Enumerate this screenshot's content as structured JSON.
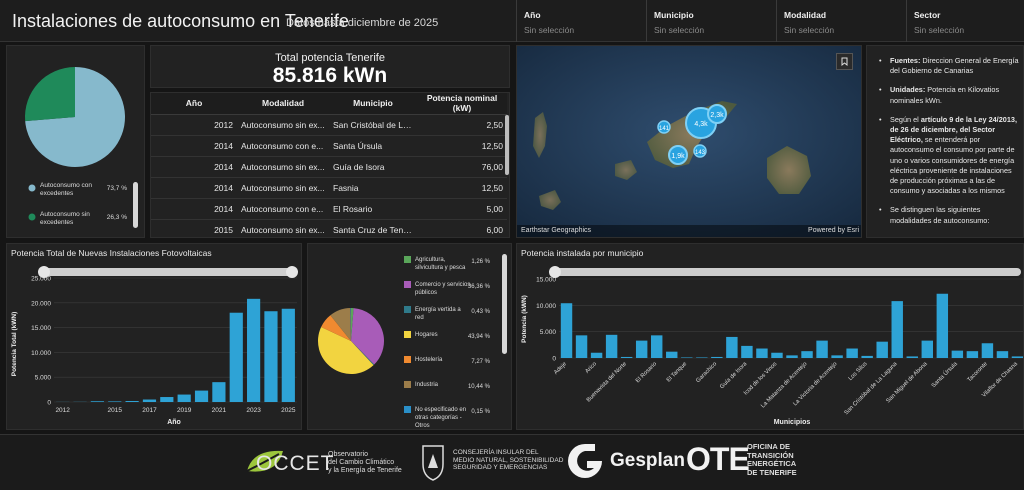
{
  "header": {
    "title": "Instalaciones de autoconsumo en Tenerife",
    "subtitle": "Datos hasta diciembre de 2025",
    "filters": [
      {
        "label": "Año",
        "value": "Sin selección"
      },
      {
        "label": "Municipio",
        "value": "Sin selección"
      },
      {
        "label": "Modalidad",
        "value": "Sin selección"
      },
      {
        "label": "Sector",
        "value": "Sin selección"
      }
    ]
  },
  "total": {
    "label": "Total potencia Tenerife",
    "value": "85.816 kWn"
  },
  "table": {
    "columns": [
      "Año",
      "Modalidad",
      "Municipio",
      "Potencia nominal (kW)"
    ],
    "rows": [
      [
        "2012",
        "Autoconsumo sin ex...",
        "San Cristóbal de La ...",
        "2,50"
      ],
      [
        "2014",
        "Autoconsumo con e...",
        "Santa Úrsula",
        "12,50"
      ],
      [
        "2014",
        "Autoconsumo sin ex...",
        "Guía de Isora",
        "76,00"
      ],
      [
        "2014",
        "Autoconsumo sin ex...",
        "Fasnia",
        "12,50"
      ],
      [
        "2014",
        "Autoconsumo con e...",
        "El Rosario",
        "5,00"
      ],
      [
        "2015",
        "Autoconsumo sin ex...",
        "Santa Cruz de Tenerife",
        "6,00"
      ]
    ]
  },
  "map": {
    "clusters": [
      "4,3k",
      "2,3k",
      "141",
      "1,9k",
      "143"
    ],
    "attribution": "Earthstar Geographics",
    "powered": "Powered by Esri",
    "bookmark_icon": "bookmark-icon"
  },
  "info": {
    "items": [
      {
        "bold": "Fuentes:",
        "text": " Direccion General de Energía del Gobierno de Canarias"
      },
      {
        "bold": "Unidades:",
        "text": " Potencia en Kilovatios nominales kWn."
      },
      {
        "pre": "Según el ",
        "bold": "artículo 9 de la Ley 24/2013, de 26 de diciembre, del Sector Eléctrico,",
        "text": " se entenderá por autoconsumo el consumo por parte de uno o varios consumidores de energía eléctrica proveniente de instalaciones de producción próximas a las de consumo y asociadas a los mismos"
      },
      {
        "text": "Se distinguen las siguientes modalidades de autoconsumo:"
      }
    ]
  },
  "chart_data": [
    {
      "type": "pie",
      "categories": [
        "Autoconsumo con excedentes",
        "Autoconsumo sin excedentes"
      ],
      "values": [
        73.7,
        26.3
      ],
      "labels": [
        "73,7 %",
        "26,3 %"
      ],
      "colors": [
        "#86b9cc",
        "#1f8a5a"
      ]
    },
    {
      "type": "bar",
      "title": "Potencia Total de Nuevas Instalaciones Fotovoltaicas",
      "xlabel": "Año",
      "ylabel": "Potencia Total (kWN)",
      "categories": [
        "2012",
        "2013",
        "2014",
        "2015",
        "2016",
        "2017",
        "2018",
        "2019",
        "2020",
        "2021",
        "2022",
        "2023",
        "2024",
        "2025"
      ],
      "values": [
        20,
        30,
        150,
        120,
        200,
        500,
        1000,
        1500,
        2300,
        4000,
        18000,
        20800,
        18300,
        18800
      ],
      "tick_labels_x": [
        "2012",
        "2015",
        "2017",
        "2019",
        "2021",
        "2023",
        "2025"
      ],
      "yticks": [
        "0",
        "5.000",
        "10.000",
        "15.000",
        "20.000",
        "25.000"
      ],
      "ylim": [
        0,
        25000
      ],
      "color": "#2ea3d6"
    },
    {
      "type": "pie",
      "categories": [
        "Agricultura, silvicultura y pesca",
        "Comercio y servicios públicos",
        "Energía vertida a red",
        "Hogares",
        "Hostelería",
        "Industria",
        "No especificado en otras categorías - Otros",
        "Transporte"
      ],
      "values": [
        1.26,
        36.36,
        0.43,
        43.94,
        7.27,
        10.44,
        0.15,
        0.16
      ],
      "labels": [
        "1,26 %",
        "36,36 %",
        "0,43 %",
        "43,94 %",
        "7,27 %",
        "10,44 %",
        "0,15 %",
        "0,16 %"
      ],
      "colors": [
        "#5aa65a",
        "#a85cb8",
        "#2f7a8a",
        "#f2d440",
        "#f08a30",
        "#9c7d4a",
        "#2a8fc8",
        "#2a8fc8"
      ]
    },
    {
      "type": "bar",
      "title": "Potencia instalada por municipio",
      "xlabel": "Municipios",
      "ylabel": "Potencia (kWN)",
      "categories": [
        "Adeje",
        "Arafo",
        "Arico",
        "Arona",
        "Buenavista del Norte",
        "Candelaria",
        "El Rosario",
        "El Sauzal",
        "El Tanque",
        "Fasnia",
        "Garachico",
        "Granadilla de Abona",
        "Guía de Isora",
        "Güímar",
        "Icod de los Vinos",
        "La Guancha",
        "La Matanza de Acentejo",
        "La Orotava",
        "La Victoria de Acentejo",
        "Los Realejos",
        "Los Silos",
        "Puerto de la Cruz",
        "San Cristóbal de La Laguna",
        "San Juan de la Rambla",
        "San Miguel de Abona",
        "Santa Cruz de Tenerife",
        "Santa Úrsula",
        "Santiago del Teide",
        "Tacoronte",
        "Tegueste",
        "Vilaflor de Chasna"
      ],
      "tick_labels_x": [
        "Adeje",
        "Arico",
        "Buenavista del Norte",
        "El Rosario",
        "El Tanque",
        "Garachico",
        "Guía de Isora",
        "Icod de los Vinos",
        "La Matanza de Acentejo",
        "La Victoria de Acentejo",
        "Los Silos",
        "San Cristóbal de La Laguna",
        "San Miguel de Abona",
        "Santa Úrsula",
        "Tacoronte",
        "Vilaflor de Chasna"
      ],
      "values": [
        10400,
        4300,
        1000,
        4400,
        200,
        3300,
        4300,
        1200,
        100,
        100,
        200,
        4000,
        2300,
        1800,
        1000,
        500,
        1300,
        3300,
        500,
        1800,
        400,
        3100,
        10800,
        300,
        3300,
        12200,
        1400,
        1300,
        2800,
        1300,
        300
      ],
      "yticks": [
        "0",
        "5.000",
        "10.000",
        "15.000"
      ],
      "ylim": [
        0,
        15000
      ],
      "color": "#2ea3d6"
    }
  ],
  "footer": {
    "occet": "OCCET",
    "occet_sub": [
      "Observatorio",
      "del Cambio Climático",
      "y la Energía de Tenerife"
    ],
    "consejeria": [
      "CONSEJERÍA INSULAR DEL",
      "MEDIO NATURAL, SOSTENIBILIDAD",
      "SEGURIDAD Y EMERGENCIAS"
    ],
    "gesplan": "Gesplan",
    "ote": "OTE",
    "ote_sub": [
      "OFICINA DE",
      "TRANSICIÓN",
      "ENERGÉTICA",
      "DE TENERIFE"
    ]
  }
}
